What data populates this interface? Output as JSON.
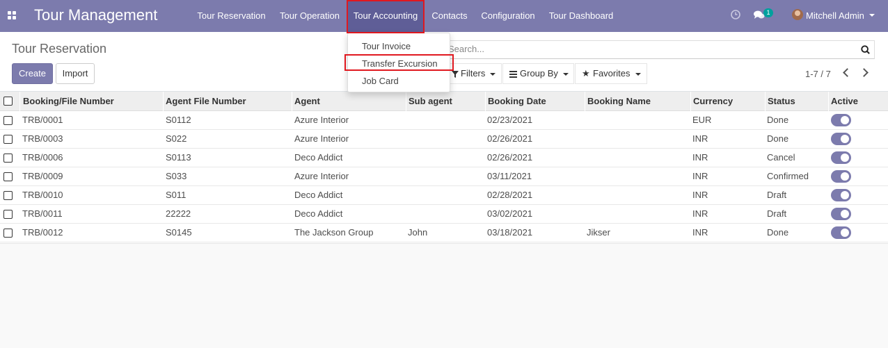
{
  "app": {
    "title": "Tour Management",
    "menu": [
      "Tour Reservation",
      "Tour Operation",
      "Tour Accounting",
      "Contacts",
      "Configuration",
      "Tour Dashboard"
    ],
    "active_menu": "Tour Accounting",
    "messages_badge": "1",
    "user_name": "Mitchell Admin"
  },
  "dropdown": {
    "items": [
      "Tour Invoice",
      "Transfer Excursion",
      "Job Card"
    ],
    "highlighted": "Transfer Excursion"
  },
  "control_panel": {
    "title": "Tour Reservation",
    "create_label": "Create",
    "import_label": "Import",
    "search_placeholder": "Search...",
    "filters_label": "Filters",
    "group_by_label": "Group By",
    "favorites_label": "Favorites",
    "pager": "1-7 / 7"
  },
  "table": {
    "columns": [
      "Booking/File Number",
      "Agent File Number",
      "Agent",
      "Sub agent",
      "Booking Date",
      "Booking Name",
      "Currency",
      "Status",
      "Active"
    ],
    "rows": [
      {
        "booking": "TRB/0001",
        "agent_file": "S0112",
        "agent": "Azure Interior",
        "sub_agent": "",
        "date": "02/23/2021",
        "name": "",
        "currency": "EUR",
        "status": "Done",
        "active": true
      },
      {
        "booking": "TRB/0003",
        "agent_file": "S022",
        "agent": "Azure Interior",
        "sub_agent": "",
        "date": "02/26/2021",
        "name": "",
        "currency": "INR",
        "status": "Done",
        "active": true
      },
      {
        "booking": "TRB/0006",
        "agent_file": "S0113",
        "agent": "Deco Addict",
        "sub_agent": "",
        "date": "02/26/2021",
        "name": "",
        "currency": "INR",
        "status": "Cancel",
        "active": true
      },
      {
        "booking": "TRB/0009",
        "agent_file": "S033",
        "agent": "Azure Interior",
        "sub_agent": "",
        "date": "03/11/2021",
        "name": "",
        "currency": "INR",
        "status": "Confirmed",
        "active": true
      },
      {
        "booking": "TRB/0010",
        "agent_file": "S011",
        "agent": "Deco Addict",
        "sub_agent": "",
        "date": "02/28/2021",
        "name": "",
        "currency": "INR",
        "status": "Draft",
        "active": true
      },
      {
        "booking": "TRB/0011",
        "agent_file": "22222",
        "agent": "Deco Addict",
        "sub_agent": "",
        "date": "03/02/2021",
        "name": "",
        "currency": "INR",
        "status": "Draft",
        "active": true
      },
      {
        "booking": "TRB/0012",
        "agent_file": "S0145",
        "agent": "The Jackson Group",
        "sub_agent": "John",
        "date": "03/18/2021",
        "name": "Jikser",
        "currency": "INR",
        "status": "Done",
        "active": true
      }
    ]
  },
  "colors": {
    "brand": "#7c7bad",
    "highlight_border": "#e0181f",
    "badge": "#00a09d"
  }
}
